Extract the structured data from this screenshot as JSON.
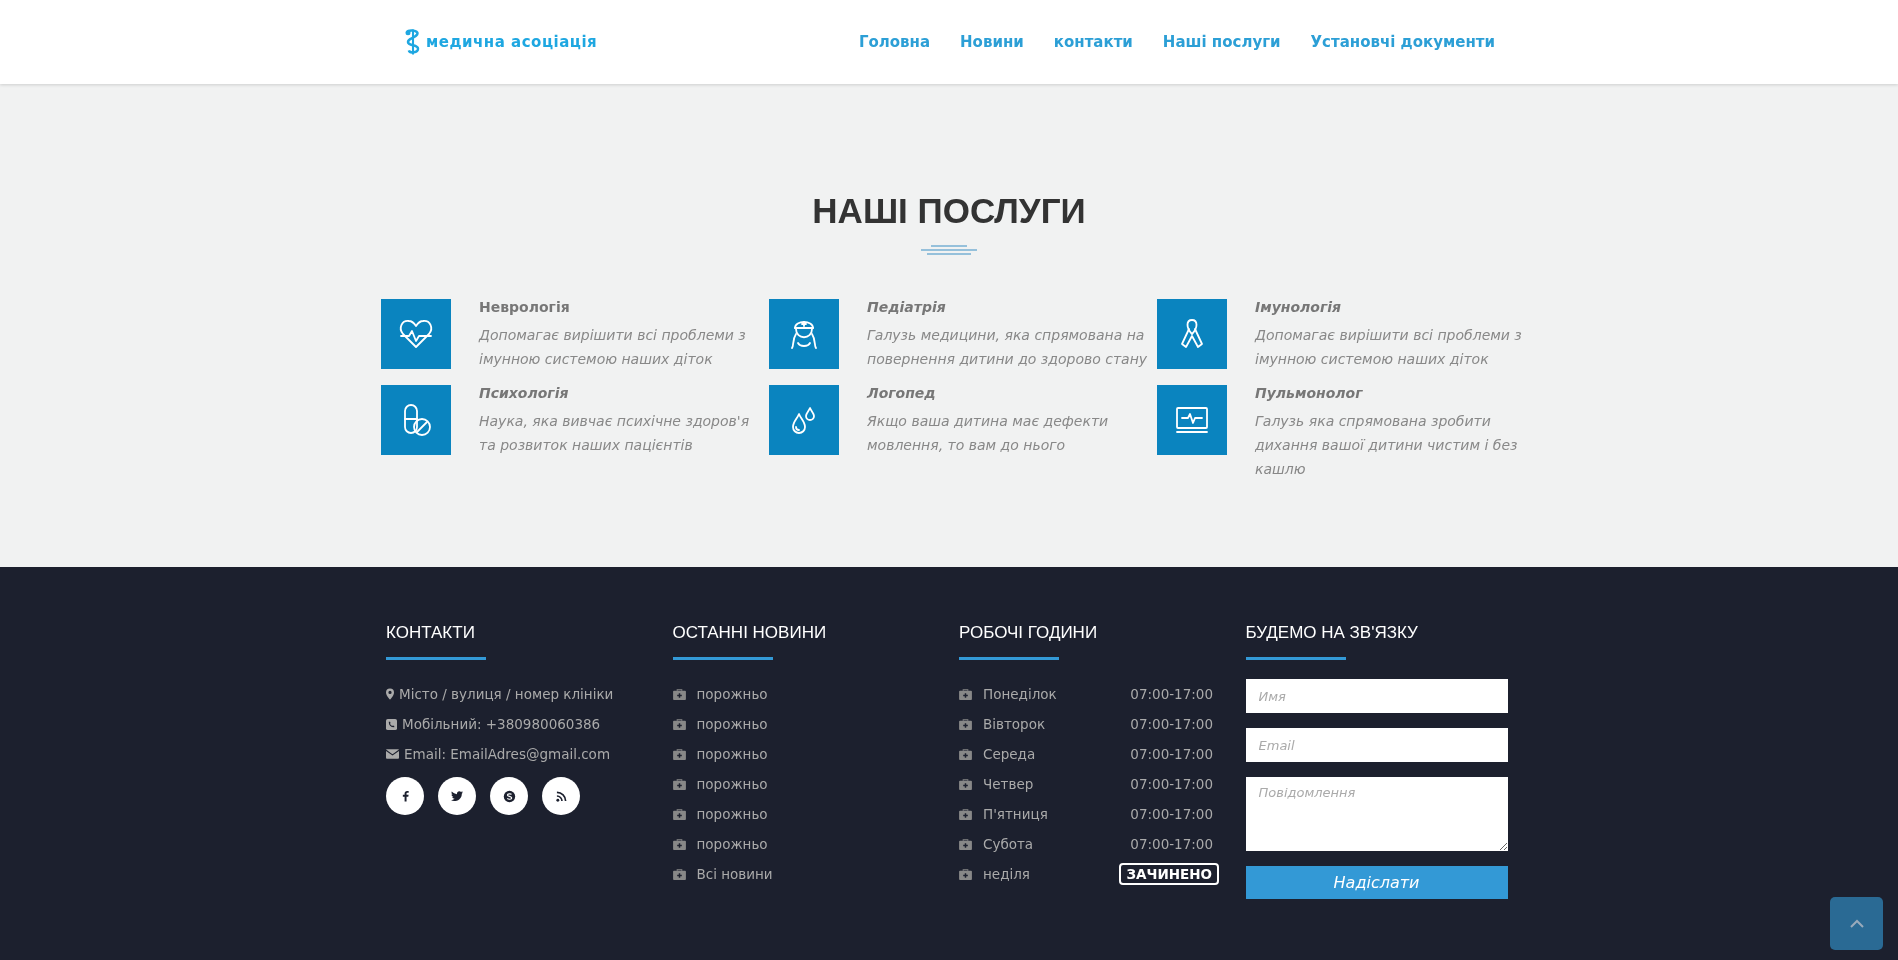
{
  "header": {
    "logo_text": "медична асоціація",
    "nav": [
      "Головна",
      "Новини",
      "контакти",
      "Наші послуги",
      "Установчі документи"
    ]
  },
  "services": {
    "title": "НАШІ ПОСЛУГИ",
    "items": [
      {
        "title": "Неврологія",
        "italic": false,
        "text": "Допомагає вирішити всі проблеми з імунною системою наших діток"
      },
      {
        "title": "Педіатрія",
        "italic": true,
        "text": "Галузь медицини, яка спрямована на повернення дитини до здорово стану"
      },
      {
        "title": "Імунологія",
        "italic": true,
        "text": "Допомагає вирішити всі проблеми з імунною системою наших діток"
      },
      {
        "title": "Психологія",
        "italic": true,
        "text": "Наука, яка вивчає психічне здоров'я та розвиток наших пацієнтів"
      },
      {
        "title": "Логопед",
        "italic": true,
        "text": "Якщо ваша дитина має дефекти мовлення, то вам до нього"
      },
      {
        "title": "Пульмонолог",
        "italic": true,
        "text": "Галузь яка спрямована зробити дихання вашої дитини чистим і без кашлю"
      }
    ]
  },
  "footer": {
    "contacts": {
      "title": "КОНТАКТИ",
      "items": [
        {
          "kind": "pin",
          "text": "Місто / вулиця / номер клініки"
        },
        {
          "kind": "phone",
          "text": "Мобільний: +380980060386"
        },
        {
          "kind": "mail",
          "text": "Email: EmailAdres@gmail.com"
        }
      ]
    },
    "news": {
      "title": "ОСТАННІ НОВИНИ",
      "items": [
        "порожньо",
        "порожньо",
        "порожньо",
        "порожньо",
        "порожньо",
        "порожньо",
        "Всі новини"
      ]
    },
    "hours": {
      "title": "РОБОЧІ ГОДИНИ",
      "items": [
        {
          "day": "Понеділок",
          "time": "07:00-17:00",
          "closed": false
        },
        {
          "day": "Вівторок",
          "time": "07:00-17:00",
          "closed": false
        },
        {
          "day": "Середа",
          "time": "07:00-17:00",
          "closed": false
        },
        {
          "day": "Четвер",
          "time": "07:00-17:00",
          "closed": false
        },
        {
          "day": "П'ятниця",
          "time": "07:00-17:00",
          "closed": false
        },
        {
          "day": "Субота",
          "time": "07:00-17:00",
          "closed": false
        },
        {
          "day": "неділя",
          "time": "ЗАЧИНЕНО",
          "closed": true
        }
      ]
    },
    "contact_form": {
      "title": "БУДЕМО НА ЗВ'ЯЗКУ",
      "name_placeholder": "Имя",
      "email_placeholder": "Email",
      "message_placeholder": "Повідомлення",
      "button": "Надіслати"
    }
  }
}
